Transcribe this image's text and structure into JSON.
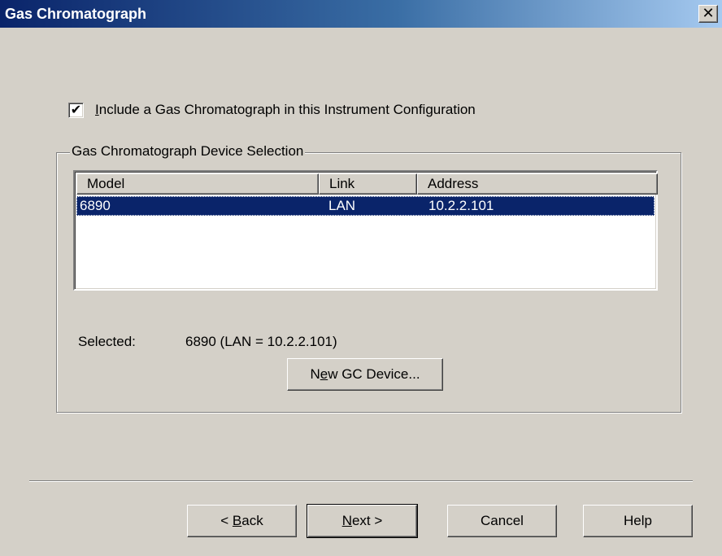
{
  "window": {
    "title": "Gas Chromatograph",
    "close_glyph": "✕",
    "close_icon": "close-icon"
  },
  "include_gc": {
    "checked": true,
    "check_glyph": "✔",
    "label_accel": "I",
    "label_rest": "nclude a Gas Chromatograph in this Instrument Configuration"
  },
  "device_selection": {
    "group_label": "Gas Chromatograph Device Selection",
    "columns": [
      "Model",
      "Link",
      "Address"
    ],
    "rows": [
      {
        "model": "6890",
        "link": "LAN",
        "address": "10.2.2.101",
        "selected": true
      }
    ],
    "selected_label": "Selected:",
    "selected_value": "6890 (LAN = 10.2.2.101)",
    "new_device_button": {
      "before": "N",
      "accel": "e",
      "after": "w GC Device..."
    }
  },
  "buttons": {
    "back": {
      "before": "< ",
      "accel": "B",
      "after": "ack"
    },
    "next": {
      "before": "",
      "accel": "N",
      "after": "ext >",
      "default": true
    },
    "cancel": "Cancel",
    "help": "Help"
  },
  "colors": {
    "face": "#d4d0c8",
    "title_gradient_start": "#0a246a",
    "title_gradient_end": "#a6caf0",
    "selection": "#0a246a"
  }
}
